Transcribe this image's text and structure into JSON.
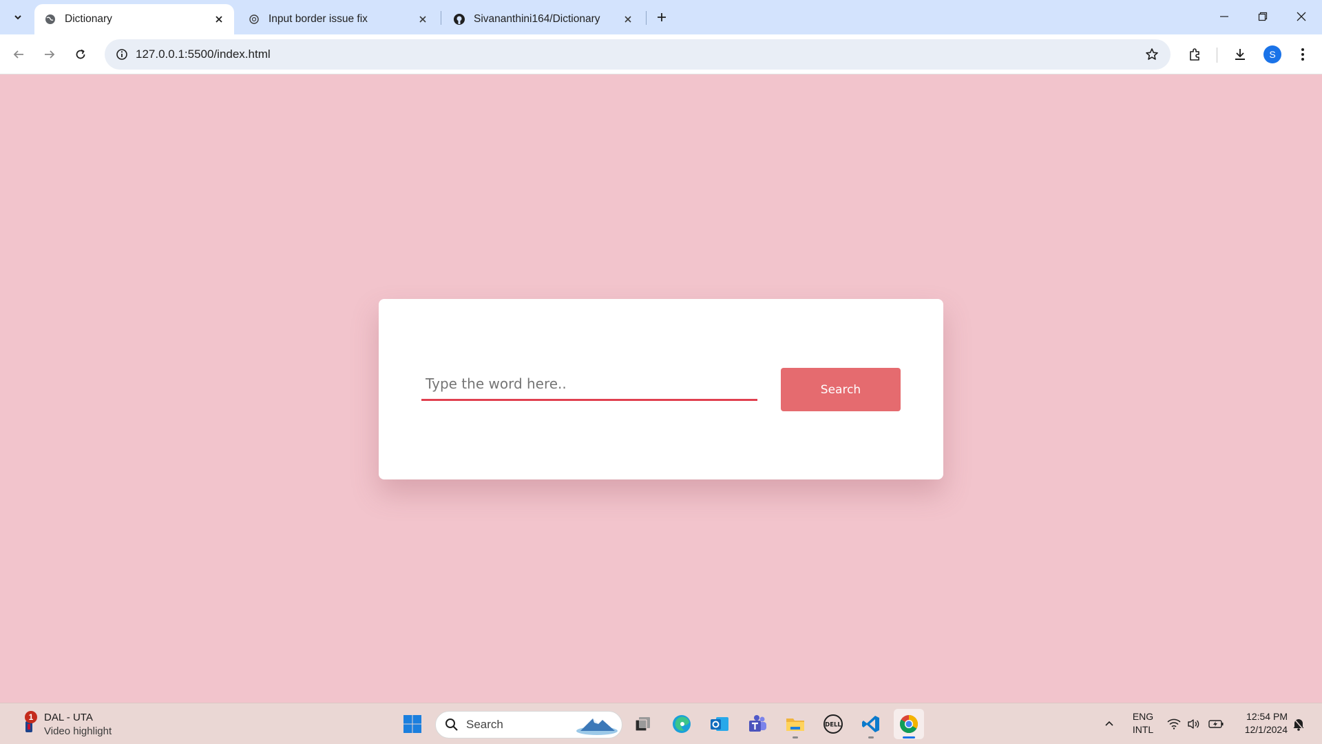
{
  "browser": {
    "tabs": [
      {
        "title": "Dictionary",
        "active": true
      },
      {
        "title": "Input border issue fix",
        "active": false
      },
      {
        "title": "Sivananthini164/Dictionary",
        "active": false
      }
    ],
    "url": "127.0.0.1:5500/index.html",
    "profile_initial": "S"
  },
  "page": {
    "input_placeholder": "Type the word here..",
    "search_button_label": "Search",
    "background_color": "#f2c4cc",
    "button_color": "#e56b6f",
    "input_underline_color": "#e0404f"
  },
  "taskbar": {
    "weather_badge": "1",
    "weather_title": "DAL - UTA",
    "weather_subtitle": "Video highlight",
    "search_label": "Search",
    "apps": [
      "windows-start",
      "task-view",
      "edge",
      "outlook",
      "teams",
      "file-explorer",
      "dell",
      "vscode",
      "chrome"
    ],
    "language_line1": "ENG",
    "language_line2": "INTL",
    "time": "12:54 PM",
    "date": "12/1/2024"
  }
}
